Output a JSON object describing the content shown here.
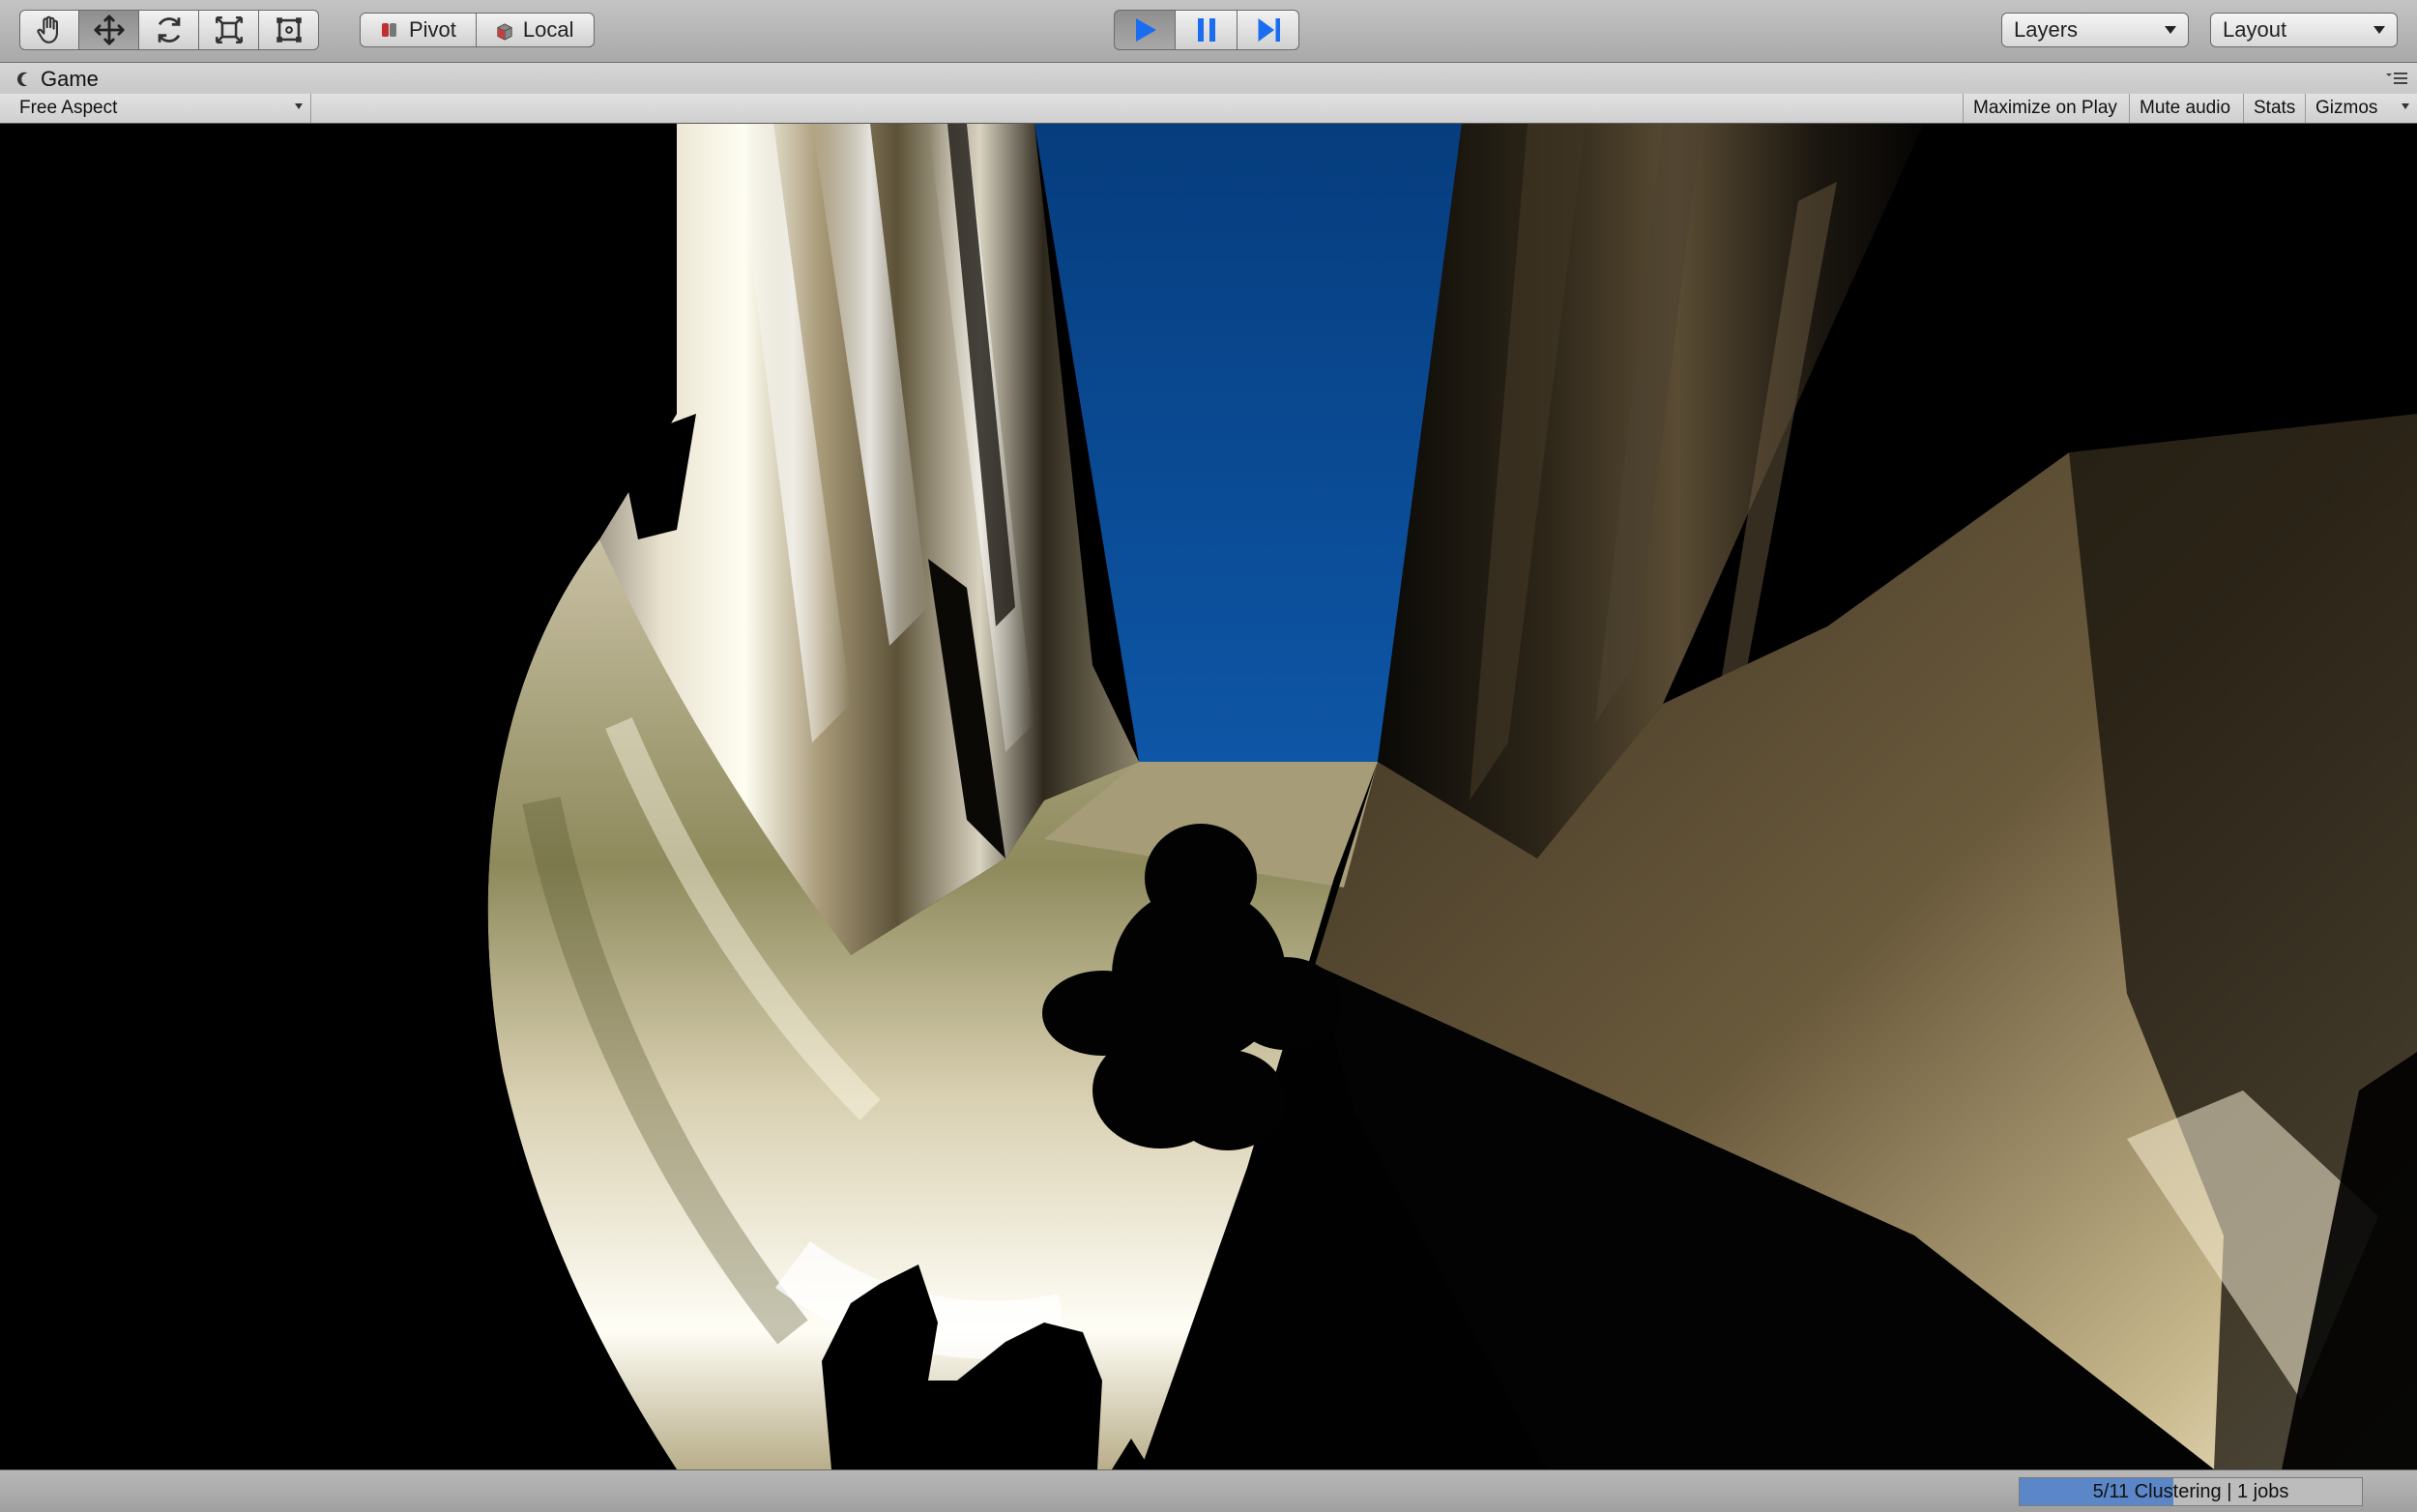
{
  "toolbar": {
    "tools": [
      {
        "name": "hand-tool",
        "icon": "hand-icon"
      },
      {
        "name": "move-tool",
        "icon": "move-arrows-icon",
        "active": true
      },
      {
        "name": "rotate-tool",
        "icon": "rotate-icon"
      },
      {
        "name": "scale-tool",
        "icon": "scale-icon"
      },
      {
        "name": "rect-tool",
        "icon": "rect-icon"
      }
    ],
    "pivot_label": "Pivot",
    "local_label": "Local",
    "play_controls": {
      "play": "play-icon",
      "pause": "pause-icon",
      "step": "step-icon",
      "play_active": true
    },
    "layers_label": "Layers",
    "layout_label": "Layout"
  },
  "tab": {
    "title": "Game"
  },
  "game_view": {
    "aspect_label": "Free Aspect",
    "maximize_label": "Maximize on Play",
    "mute_label": "Mute audio",
    "stats_label": "Stats",
    "gizmos_label": "Gizmos"
  },
  "status": {
    "progress_text": "5/11 Clustering | 1 jobs",
    "progress_fraction": 0.45
  },
  "colors": {
    "accent": "#2a6ee6",
    "sky": "#0a4a8c",
    "progress": "#5b86c8"
  }
}
